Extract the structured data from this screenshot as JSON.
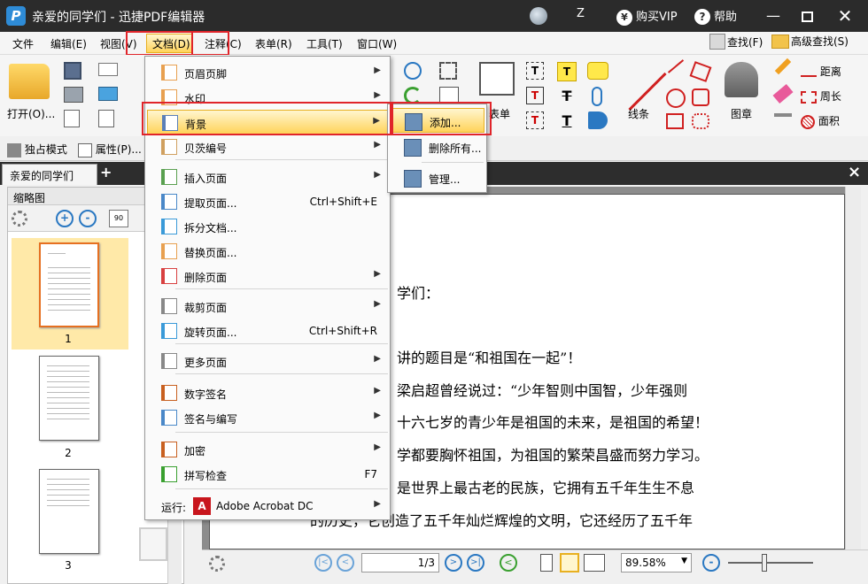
{
  "window": {
    "title": "亲爱的同学们 - 迅捷PDF编辑器",
    "user": "Z",
    "vip": "购买VIP",
    "help": "帮助"
  },
  "menubar": [
    "文件",
    "编辑(E)",
    "视图(V)",
    "文档(D)",
    "注释(C)",
    "表单(R)",
    "工具(T)",
    "窗口(W)"
  ],
  "ribbon": {
    "open": "打开(O)...",
    "table": "表单",
    "line": "线条",
    "stamp": "图章",
    "distance": "距离",
    "perimeter": "周长",
    "area": "面积",
    "find": "查找(F)",
    "adv_find": "高级查找(S)"
  },
  "row2": {
    "exclusive": "独占模式",
    "props": "属性(P)..."
  },
  "tab": {
    "name": "亲爱的同学们",
    "plus": "+",
    "close": "×"
  },
  "sidebar": {
    "title": "缩略图",
    "pages": [
      "1",
      "2",
      "3"
    ]
  },
  "doc_lines": [
    "学们：",
    "讲的题目是“和祖国在一起”！",
    "梁启超曾经说过：“少年智则中国智，少年强则",
    "十六七岁的青少年是祖国的未来，是祖国的希望！",
    "学都要胸怀祖国，为祖国的繁荣昌盛而努力学习。",
    "是世界上最古老的民族，它拥有五千年生生不息",
    "的历史，它创造了五千年灿烂辉煌的文明，它还经历了五千年"
  ],
  "dropdown": [
    {
      "label": "页眉页脚",
      "shortcut": "",
      "arrow": true
    },
    {
      "label": "水印",
      "shortcut": "",
      "arrow": true
    },
    {
      "label": "背景",
      "shortcut": "",
      "arrow": true
    },
    {
      "label": "贝茨编号",
      "shortcut": "",
      "arrow": true
    },
    {
      "label": "插入页面",
      "shortcut": "",
      "arrow": true
    },
    {
      "label": "提取页面...",
      "shortcut": "Ctrl+Shift+E",
      "arrow": false
    },
    {
      "label": "拆分文档...",
      "shortcut": "",
      "arrow": false
    },
    {
      "label": "替换页面...",
      "shortcut": "",
      "arrow": false
    },
    {
      "label": "删除页面",
      "shortcut": "",
      "arrow": true
    },
    {
      "label": "裁剪页面",
      "shortcut": "",
      "arrow": true
    },
    {
      "label": "旋转页面...",
      "shortcut": "Ctrl+Shift+R",
      "arrow": false
    },
    {
      "label": "更多页面",
      "shortcut": "",
      "arrow": true
    },
    {
      "label": "数字签名",
      "shortcut": "",
      "arrow": true
    },
    {
      "label": "签名与编写",
      "shortcut": "",
      "arrow": true
    },
    {
      "label": "加密",
      "shortcut": "",
      "arrow": true
    },
    {
      "label": "拼写检查",
      "shortcut": "F7",
      "arrow": false
    },
    {
      "label": "Adobe Acrobat DC",
      "shortcut": "",
      "arrow": true
    }
  ],
  "run_label": "运行:",
  "submenu": [
    "添加...",
    "删除所有...",
    "管理..."
  ],
  "status": {
    "page": "1/3",
    "zoom": "89.58%"
  },
  "colors": {
    "highlight": "#e0242a",
    "selected": "#ffd35a",
    "title_bg": "#2b2b2b"
  }
}
